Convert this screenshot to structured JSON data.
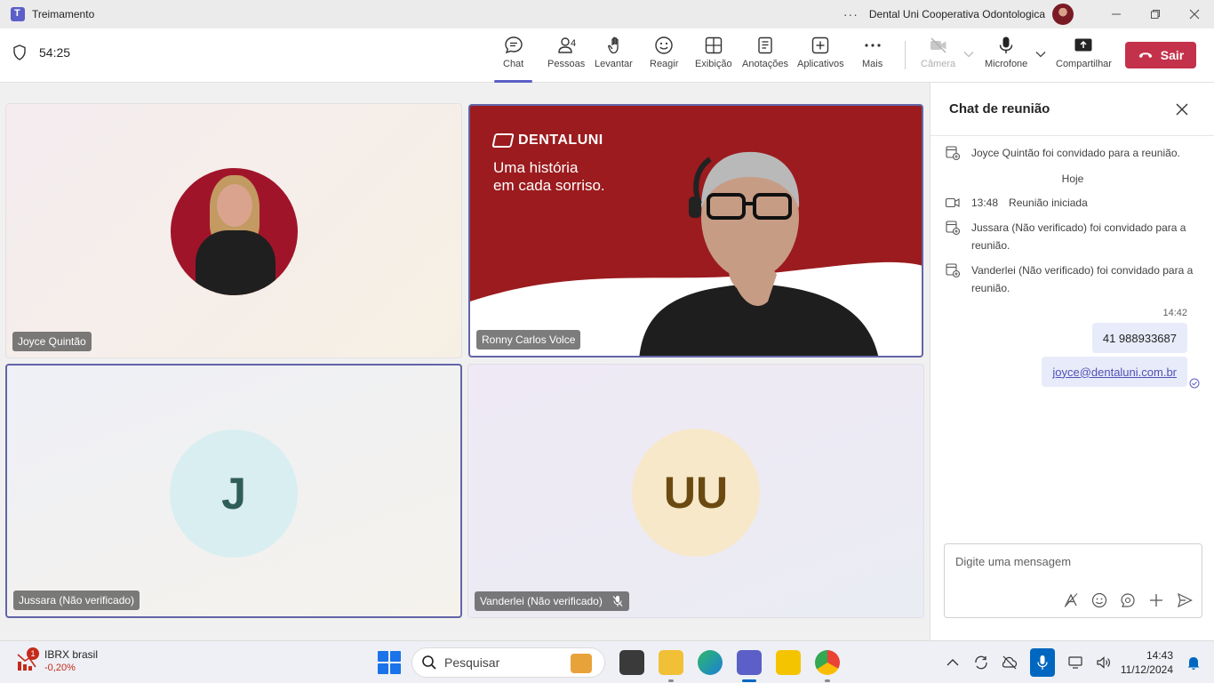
{
  "window": {
    "title": "Treimamento",
    "org_name": "Dental Uni Cooperativa Odontologica",
    "more_label": "···"
  },
  "toolbar": {
    "timer": "54:25",
    "items": [
      {
        "label": "Chat",
        "icon": "chat-icon"
      },
      {
        "label": "Pessoas",
        "icon": "people-icon",
        "count": "4"
      },
      {
        "label": "Levantar",
        "icon": "raise-hand-icon"
      },
      {
        "label": "Reagir",
        "icon": "react-icon"
      },
      {
        "label": "Exibição",
        "icon": "view-icon"
      },
      {
        "label": "Anotações",
        "icon": "notes-icon"
      },
      {
        "label": "Aplicativos",
        "icon": "apps-icon"
      },
      {
        "label": "Mais",
        "icon": "more-icon"
      },
      {
        "label": "Câmera",
        "icon": "camera-off-icon"
      },
      {
        "label": "Microfone",
        "icon": "mic-icon"
      },
      {
        "label": "Compartilhar",
        "icon": "share-icon"
      }
    ],
    "leave_label": "Sair",
    "leave_color": "#c4314b"
  },
  "participants": [
    {
      "name": "Joyce Quintão",
      "type": "photo"
    },
    {
      "name": "Ronny Carlos Volce",
      "type": "video"
    },
    {
      "name": "Jussara (Não verificado)",
      "type": "initials",
      "initials": "J"
    },
    {
      "name": "Vanderlei (Não verificado)",
      "type": "initials",
      "initials": "UU",
      "muted": true
    }
  ],
  "video_brand": {
    "logo": "DENTALUNI",
    "slogan_line1": "Uma história",
    "slogan_line2": "em cada sorriso."
  },
  "chat": {
    "title": "Chat de reunião",
    "events": [
      {
        "text": "Joyce Quintão foi convidado para a reunião."
      },
      {
        "text": "Reunião iniciada",
        "time": "13:48"
      },
      {
        "text": "Jussara (Não verificado) foi convidado para a reunião."
      },
      {
        "text": "Vanderlei (Não verificado) foi convidado para a reunião."
      }
    ],
    "day_separator": "Hoje",
    "message_time": "14:42",
    "messages": [
      "41 988933687",
      "joyce@dentaluni.com.br"
    ],
    "compose_placeholder": "Digite uma mensagem"
  },
  "taskbar": {
    "stock_name": "IBRX brasil",
    "stock_change": "-0,20%",
    "stock_badge": "1",
    "search_placeholder": "Pesquisar",
    "time": "14:43",
    "date": "11/12/2024"
  },
  "colors": {
    "accent": "#5b5fc7",
    "active_border": "#6264a7",
    "brand_red": "#9b1b1e"
  }
}
